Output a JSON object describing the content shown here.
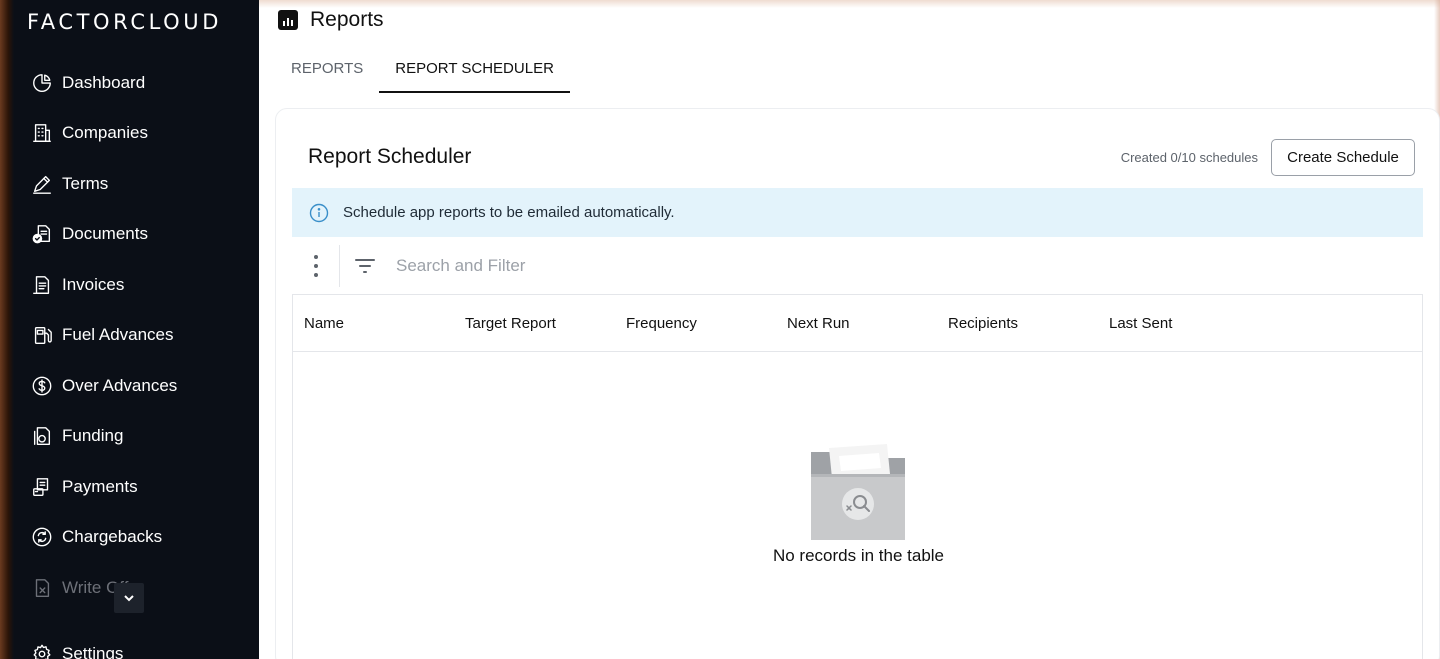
{
  "brand": {
    "logo": "FACTORCLOUD"
  },
  "sidebar": {
    "items": [
      {
        "label": "Dashboard",
        "icon": "pie-chart-icon"
      },
      {
        "label": "Companies",
        "icon": "building-icon"
      },
      {
        "label": "Terms",
        "icon": "signature-pen-icon"
      },
      {
        "label": "Documents",
        "icon": "document-check-icon"
      },
      {
        "label": "Invoices",
        "icon": "invoice-icon"
      },
      {
        "label": "Fuel Advances",
        "icon": "fuel-pump-icon"
      },
      {
        "label": "Over Advances",
        "icon": "dollar-circle-icon"
      },
      {
        "label": "Funding",
        "icon": "funding-document-icon"
      },
      {
        "label": "Payments",
        "icon": "payments-icon"
      },
      {
        "label": "Chargebacks",
        "icon": "chargeback-cycle-icon"
      },
      {
        "label": "Write Offs",
        "icon": "write-off-document-icon"
      },
      {
        "label": "Settings",
        "icon": "gear-icon"
      }
    ]
  },
  "header": {
    "title": "Reports",
    "icon": "bar-chart-icon"
  },
  "tabs": [
    {
      "label": "REPORTS",
      "active": false
    },
    {
      "label": "REPORT SCHEDULER",
      "active": true
    }
  ],
  "scheduler": {
    "title": "Report Scheduler",
    "created_count": "Created 0/10 schedules",
    "create_button": "Create Schedule",
    "info": "Schedule app reports to be emailed automatically.",
    "search_placeholder": "Search and Filter",
    "columns": [
      "Name",
      "Target Report",
      "Frequency",
      "Next Run",
      "Recipients",
      "Last Sent"
    ],
    "empty_message": "No records in the table"
  },
  "colors": {
    "sidebar_bg": "#0b0f17",
    "info_bg": "#e3f3fb",
    "info_icon": "#3a8fc9",
    "text_primary": "#111111",
    "text_muted": "#5d636b"
  }
}
